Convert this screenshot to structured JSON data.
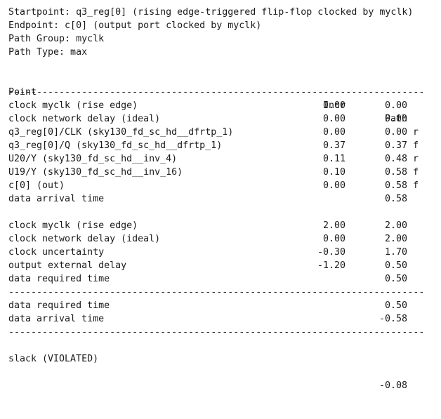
{
  "header": {
    "startpoint": "Startpoint: q3_reg[0] (rising edge-triggered flip-flop clocked by myclk)",
    "endpoint": "Endpoint: c[0] (output port clocked by myclk)",
    "path_group": "Path Group: myclk",
    "path_type": "Path Type: max"
  },
  "columns": {
    "point": "Point",
    "incr": "Incr",
    "path": "Path"
  },
  "separator": "--------------------------------------------------------------------------",
  "arrival_rows": [
    {
      "point": "clock myclk (rise edge)",
      "incr": "0.00",
      "path": "0.00",
      "edge": ""
    },
    {
      "point": "clock network delay (ideal)",
      "incr": "0.00",
      "path": "0.00",
      "edge": ""
    },
    {
      "point": "q3_reg[0]/CLK (sky130_fd_sc_hd__dfrtp_1)",
      "incr": "0.00",
      "path": "0.00",
      "edge": "r"
    },
    {
      "point": "q3_reg[0]/Q (sky130_fd_sc_hd__dfrtp_1)",
      "incr": "0.37",
      "path": "0.37",
      "edge": "f"
    },
    {
      "point": "U20/Y (sky130_fd_sc_hd__inv_4)",
      "incr": "0.11",
      "path": "0.48",
      "edge": "r"
    },
    {
      "point": "U19/Y (sky130_fd_sc_hd__inv_16)",
      "incr": "0.10",
      "path": "0.58",
      "edge": "f"
    },
    {
      "point": "c[0] (out)",
      "incr": "0.00",
      "path": "0.58",
      "edge": "f"
    },
    {
      "point": "data arrival time",
      "incr": "",
      "path": "0.58",
      "edge": ""
    }
  ],
  "required_rows": [
    {
      "point": "clock myclk (rise edge)",
      "incr": "2.00",
      "path": "2.00",
      "edge": ""
    },
    {
      "point": "clock network delay (ideal)",
      "incr": "0.00",
      "path": "2.00",
      "edge": ""
    },
    {
      "point": "clock uncertainty",
      "incr": "-0.30",
      "path": "1.70",
      "edge": ""
    },
    {
      "point": "output external delay",
      "incr": "-1.20",
      "path": "0.50",
      "edge": ""
    },
    {
      "point": "data required time",
      "incr": "",
      "path": "0.50",
      "edge": ""
    }
  ],
  "summary_rows": [
    {
      "point": "data required time",
      "incr": "",
      "path": "0.50",
      "edge": ""
    },
    {
      "point": "data arrival time",
      "incr": "",
      "path": "-0.58",
      "edge": ""
    }
  ],
  "slack": {
    "point": "slack (VIOLATED)",
    "incr": "",
    "path": "-0.08",
    "edge": ""
  }
}
